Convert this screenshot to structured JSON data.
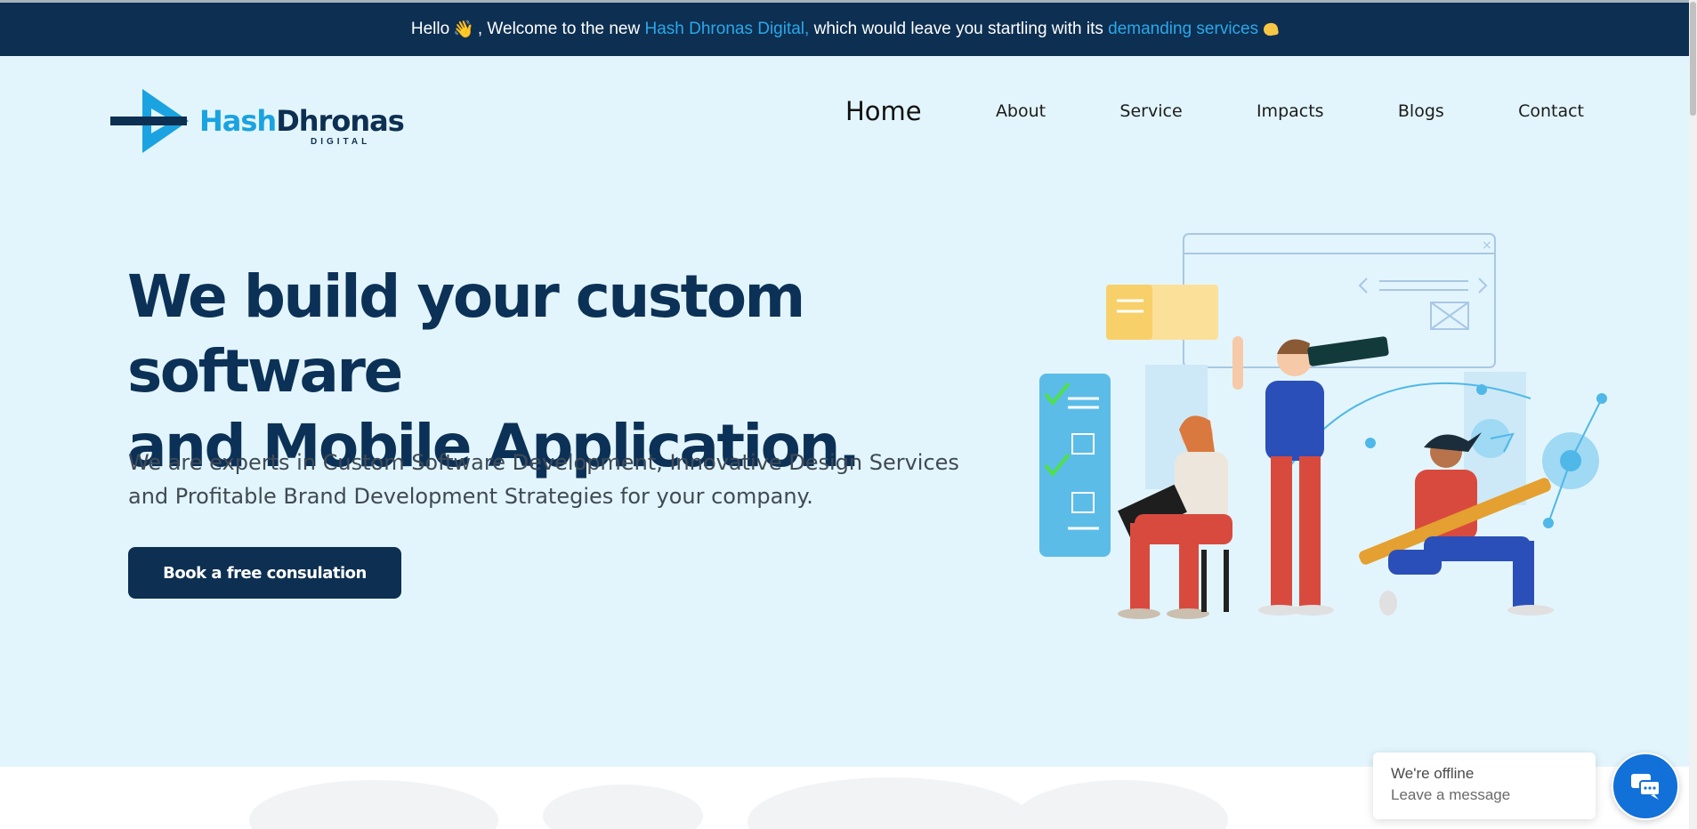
{
  "announcement": {
    "prefix": "Hello",
    "wave_emoji": "👋",
    "part1": ", Welcome to the new",
    "brand_link": "Hash Dhronas Digital,",
    "part2": "which would leave you startling with its",
    "services_link": "demanding services",
    "heart_icon": "yellow-heart-icon"
  },
  "logo": {
    "brand_first": "Hash",
    "brand_second": "Dhronas",
    "subtitle": "DIGITAL"
  },
  "nav": {
    "items": [
      {
        "label": "Home",
        "active": true
      },
      {
        "label": "About"
      },
      {
        "label": "Service"
      },
      {
        "label": "Impacts"
      },
      {
        "label": "Blogs"
      },
      {
        "label": "Contact"
      }
    ]
  },
  "hero": {
    "title_line1": "We build your custom software",
    "title_line2": "and Mobile Application.",
    "description": "We are experts in Custom Software Development, Innovative Design Services and Profitable Brand Development Strategies for your company.",
    "cta_label": "Book a free consulation"
  },
  "chat": {
    "status": "We're offline",
    "action": "Leave a message",
    "icon": "chat-icon"
  },
  "colors": {
    "navy": "#0c2f52",
    "accent_blue": "#1aa3e0",
    "hero_bg": "#e3f5fc",
    "chat_blue": "#1270d9"
  }
}
